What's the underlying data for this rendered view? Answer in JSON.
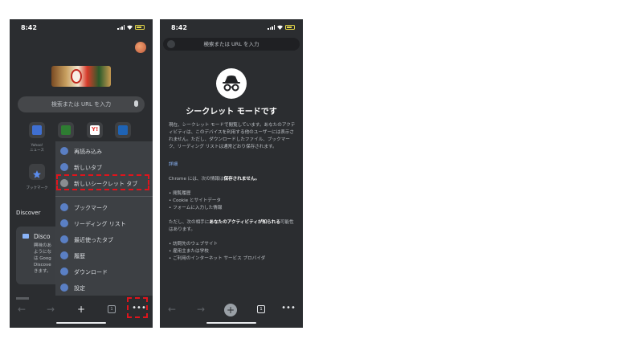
{
  "status_bar": {
    "time": "8:42"
  },
  "left": {
    "search_placeholder": "検索または URL を入力",
    "shortcuts": [
      {
        "label": "Yahoo!\nニュース",
        "color": "#3f6fd1"
      },
      {
        "label": "",
        "color": "#2e7d32"
      },
      {
        "label": "",
        "color": "#e53935"
      },
      {
        "label": "",
        "color": "#1e63b5"
      },
      {
        "label": "ブックマーク",
        "color": "#5b8def"
      }
    ],
    "discover": {
      "heading": "Discover",
      "card_title": "Disco",
      "card_lines": "興味のあ\nようにな\nは Goog\nDiscove\nきます。"
    },
    "menu": {
      "items": [
        {
          "label": "再読み込み",
          "icon": "reload-icon"
        },
        {
          "label": "新しいタブ",
          "icon": "new-tab-icon"
        },
        {
          "label": "新しいシークレット タブ",
          "icon": "incognito-icon"
        },
        {
          "label": "ブックマーク",
          "icon": "star-icon"
        },
        {
          "label": "リーディング リスト",
          "icon": "list-icon"
        },
        {
          "label": "最近使ったタブ",
          "icon": "recent-tabs-icon"
        },
        {
          "label": "履歴",
          "icon": "history-icon"
        },
        {
          "label": "ダウンロード",
          "icon": "download-icon"
        },
        {
          "label": "設定",
          "icon": "gear-icon"
        }
      ]
    },
    "tab_count": "1"
  },
  "right": {
    "search_placeholder": "検索または URL を入力",
    "title": "シークレット モードです",
    "intro": "現在、シークレット モードで閲覧しています。あなたのアクティビティは、このデバイスを利用する他のユーザーには表示されません。ただし、ダウンロードしたファイル、ブックマーク、リーディング リストは通常どおり保存されます。",
    "details_link": "詳細",
    "not_saved_prefix": "Chrome には、次の情報は",
    "not_saved_bold": "保存されません。",
    "not_saved_items": [
      "閲覧履歴",
      "Cookie とサイトデータ",
      "フォームに入力した情報"
    ],
    "visible_prefix": "ただし、次の相手に",
    "visible_bold": "あなたのアクティビティが知られる",
    "visible_suffix": "可能性はあります。",
    "visible_items": [
      "訪問先のウェブサイト",
      "雇用主または学校",
      "ご利用のインターネット サービス プロバイダ"
    ],
    "tab_count": "1"
  },
  "colors": {
    "highlight": "#e0141c",
    "background": "#2b2d30",
    "menu": "#3d4044"
  }
}
